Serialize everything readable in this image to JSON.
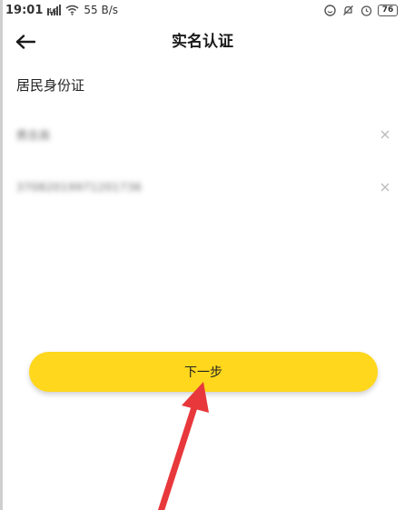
{
  "status_bar": {
    "time": "19:01",
    "signal_label": "4G",
    "net_speed": "55 B/s",
    "battery": "76"
  },
  "header": {
    "title": "实名认证"
  },
  "form": {
    "section_label": "居民身份证",
    "name_value": "费志高",
    "id_value": "37082019971201736"
  },
  "actions": {
    "next_label": "下一步"
  },
  "colors": {
    "accent": "#ffd71c",
    "annotation_arrow": "#e8383c"
  },
  "icons": [
    "back-arrow-icon",
    "clear-icon",
    "wifi-icon",
    "signal-icon",
    "battery-icon"
  ]
}
